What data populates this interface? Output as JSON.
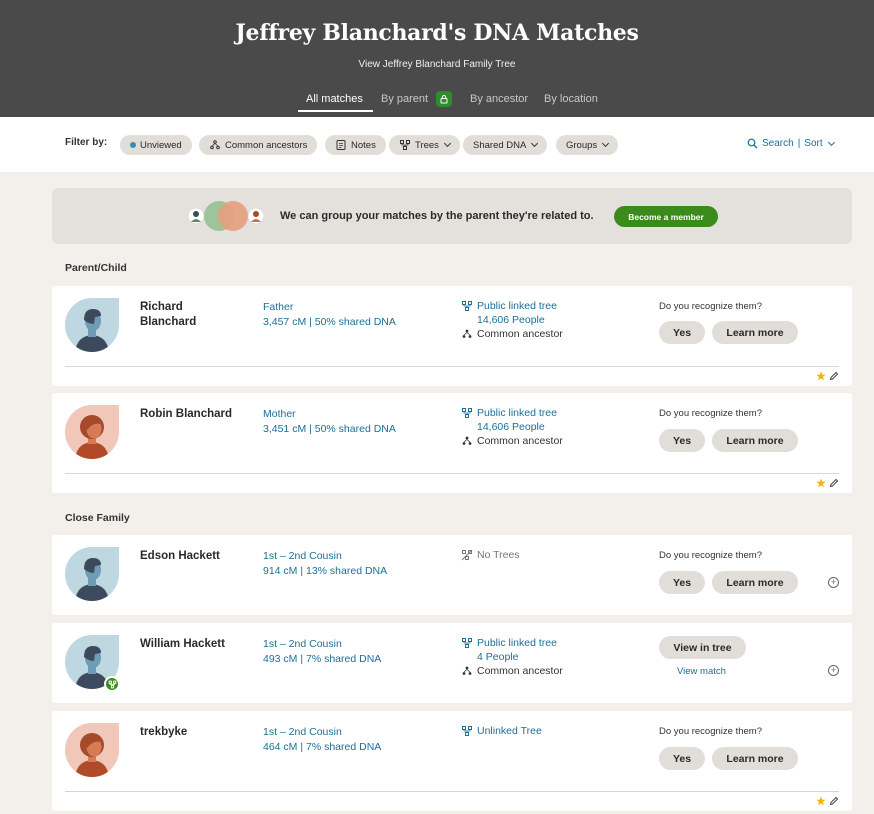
{
  "header": {
    "title": "Jeffrey Blanchard's DNA Matches",
    "tree_link": "View Jeffrey Blanchard Family Tree",
    "tabs": [
      "All matches",
      "By parent",
      "By ancestor",
      "By location"
    ]
  },
  "filters": {
    "label": "Filter by:",
    "chips": [
      "Unviewed",
      "Common ancestors",
      "Notes",
      "Trees",
      "Shared DNA",
      "Groups"
    ],
    "search": "Search",
    "separator": "|",
    "sort": "Sort"
  },
  "banner": {
    "text": "We can group your matches by the parent they're related to.",
    "button": "Become a member"
  },
  "sections": [
    "Parent/Child",
    "Close Family"
  ],
  "common": {
    "recognize": "Do you recognize them?",
    "yes": "Yes",
    "learn_more": "Learn more",
    "view_in_tree": "View in tree",
    "view_match": "View match"
  },
  "matches": [
    {
      "name": "Richard Blanchard",
      "relationship": "Father",
      "dna": "3,457 cM | 50% shared DNA",
      "tree": "Public linked tree",
      "people": "14,606 People",
      "ancestor": "Common ancestor",
      "avatar": "male",
      "starred": true
    },
    {
      "name": "Robin Blanchard",
      "relationship": "Mother",
      "dna": "3,451 cM | 50% shared DNA",
      "tree": "Public linked tree",
      "people": "14,606 People",
      "ancestor": "Common ancestor",
      "avatar": "female",
      "starred": true
    },
    {
      "name": "Edson Hackett",
      "relationship": "1st – 2nd Cousin",
      "dna": "914 cM | 13% shared DNA",
      "tree": "No Trees",
      "avatar": "male"
    },
    {
      "name": "William Hackett",
      "relationship": "1st – 2nd Cousin",
      "dna": "493 cM | 7% shared DNA",
      "tree": "Public linked tree",
      "people": "4 People",
      "ancestor": "Common ancestor",
      "avatar": "male"
    },
    {
      "name": "trekbyke",
      "relationship": "1st – 2nd Cousin",
      "dna": "464 cM | 7% shared DNA",
      "tree": "Unlinked Tree",
      "avatar": "female",
      "starred": true
    }
  ],
  "colors": {
    "header_bg": "#4a4a4a",
    "link_blue": "#1d6f95",
    "member_green": "#3a8a1c",
    "star": "#f2b705",
    "chip_bg": "#e1ddd8"
  },
  "icons": [
    "lock-icon",
    "search-icon",
    "tree-icon",
    "no-tree-icon",
    "ancestor-icon",
    "star-icon",
    "pencil-icon",
    "plus-circle-icon",
    "notes-icon"
  ]
}
